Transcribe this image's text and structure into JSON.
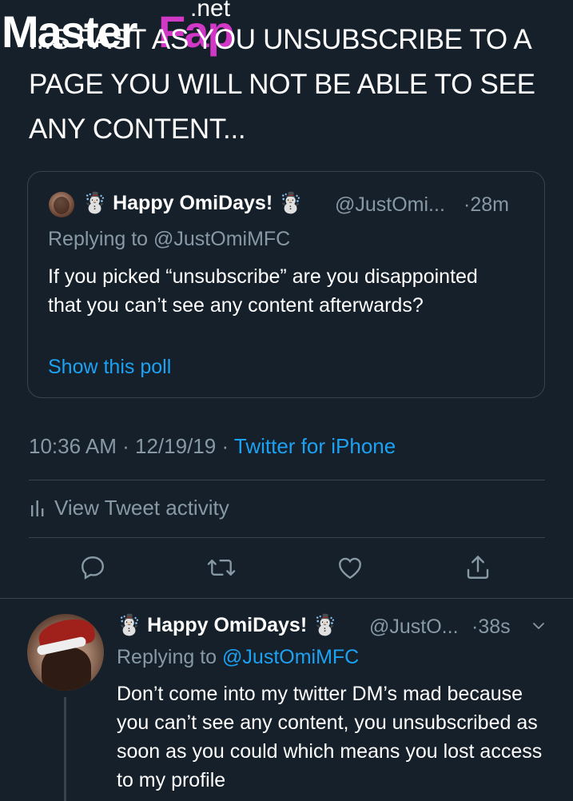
{
  "watermark": {
    "brand_a": "Master",
    "brand_b": "Fap",
    "suffix": ".net"
  },
  "tweet": {
    "text": "...S FAST AS YOU UNSUBSCRIBE TO A PAGE YOU WILL NOT BE ABLE TO SEE ANY CONTENT...",
    "time": "10:36 AM",
    "date": "12/19/19",
    "separator": "·",
    "source": "Twitter for iPhone",
    "activity_label": "View Tweet activity"
  },
  "quoted": {
    "emoji_left": "☃️",
    "display_name": "Happy OmiDays!",
    "emoji_right": "☃️",
    "handle": "@JustOmi...",
    "time": "·28m",
    "replying_to": "Replying to @JustOmiMFC",
    "body": "If you picked “unsubscribe” are you disappointed that you can’t see any content afterwards?",
    "link": "Show this poll"
  },
  "actions": {
    "reply": "reply-icon",
    "retweet": "retweet-icon",
    "like": "heart-icon",
    "share": "share-icon"
  },
  "reply": {
    "emoji_left": "☃️",
    "display_name": "Happy OmiDays!",
    "emoji_right": "☃️",
    "handle": "@JustO...",
    "time": "·38s",
    "replying_prefix": "Replying to",
    "mention": "@JustOmiMFC",
    "body": "Don’t come into my twitter DM’s mad because you can’t see any content, you unsubscribed as soon as you could which means you lost access to my profile"
  },
  "colors": {
    "background": "#15202b",
    "accent": "#1da1f2",
    "muted": "#8899a6",
    "divider": "#38444d"
  }
}
